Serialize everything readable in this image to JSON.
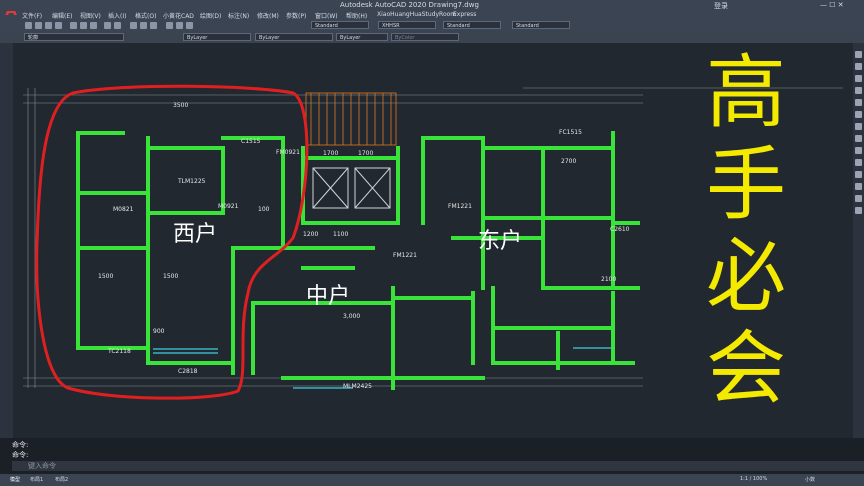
{
  "app": {
    "logo": "A",
    "title": "Autodesk AutoCAD 2020   Drawing7.dwg",
    "user": "登录",
    "search_hint": ""
  },
  "menu": [
    "文件(F)",
    "编辑(E)",
    "视图(V)",
    "插入(I)",
    "格式(O)",
    "小黄花CAD",
    "绘图(D)",
    "标注(N)",
    "修改(M)",
    "参数(P)",
    "窗口(W)",
    "帮助(H)",
    "XiaoHuangHuaStudyRoom",
    "Express"
  ],
  "toolbar": {
    "style1": "Standard",
    "style2": "XHHSR",
    "style3": "Standard",
    "style4": "Standard",
    "layer": "轮廓",
    "color": "ByLayer",
    "linetype": "ByLayer",
    "lineweight": "ByLayer",
    "plotstyle": "ByColor"
  },
  "drawing": {
    "room_labels": [
      "西户",
      "中户",
      "东户"
    ],
    "dimensions": [
      "3500",
      "1700",
      "1700",
      "1500",
      "1500",
      "900",
      "3,000",
      "1200",
      "100",
      "2700",
      "1100",
      "2100"
    ],
    "tags": [
      "TLM1225",
      "FM1221",
      "FM0921",
      "M0921",
      "C1515",
      "C2818",
      "TC2118",
      "FC1515",
      "MLM2425",
      "C2610",
      "M0821",
      "FM1221"
    ],
    "overlay_text": [
      "高",
      "手",
      "必",
      "会"
    ]
  },
  "command": {
    "line1": "命令:",
    "line2": "命令:",
    "placeholder": "键入命令"
  },
  "status": {
    "model": "模型",
    "tabs": [
      "布局1",
      "布局2"
    ],
    "scale": "1:1 / 100%",
    "right_info": "小数"
  },
  "colors": {
    "wall": "#39e339",
    "overlay": "#f4ea00",
    "highlight": "#e02020",
    "background": "#212830"
  }
}
